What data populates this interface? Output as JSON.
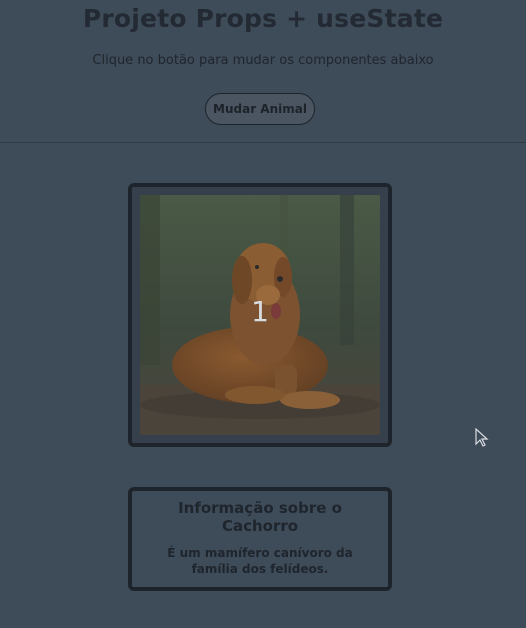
{
  "header": {
    "title": "Projeto Props + useState",
    "subtitle": "Clique no botão para mudar os componentes abaixo",
    "button_label": "Mudar Animal"
  },
  "image_card": {
    "image_subject": "golden retriever dog lying on ground",
    "overlay_number": "1"
  },
  "info_card": {
    "title": "Informação sobre o Cachorro",
    "text": "É um mamífero canívoro da família dos felídeos."
  },
  "colors": {
    "background": "#3e4b59",
    "border": "#1e242b",
    "text": "#1f252d"
  }
}
